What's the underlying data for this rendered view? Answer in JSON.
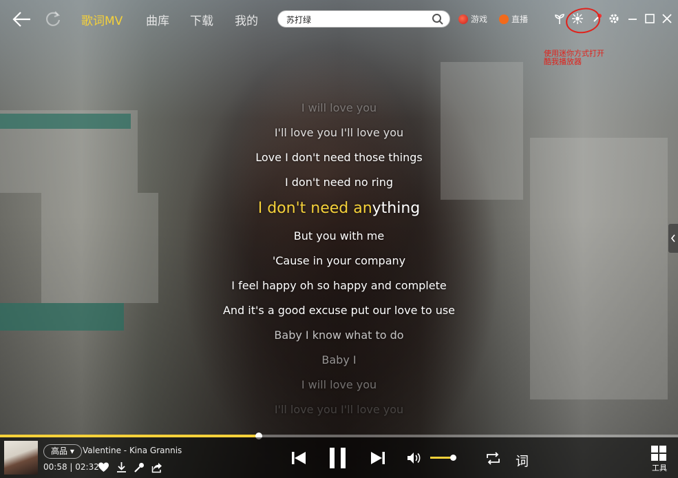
{
  "nav": {
    "tabs": [
      {
        "label": "歌词MV",
        "active": true
      },
      {
        "label": "曲库",
        "active": false
      },
      {
        "label": "下载",
        "active": false
      },
      {
        "label": "我的",
        "active": false
      }
    ]
  },
  "search": {
    "value": "苏打绿"
  },
  "topLinks": {
    "game": "游戏",
    "live": "直播"
  },
  "annotation": "使用迷你方式打开酷我播放器",
  "lyrics": {
    "lines": [
      "I will love you",
      "I'll love you I'll love you",
      "Love I don't need those things",
      "I don't need no ring",
      "But you with me",
      "'Cause in your company",
      "I feel happy oh so happy and complete",
      "And it's a good excuse put our love to use",
      "Baby I know what to do",
      "Baby I",
      "I will love you",
      "I'll love you I'll love you"
    ],
    "current_sung": "I don't need an",
    "current_rest": "ything"
  },
  "player": {
    "quality": "高品",
    "song": "Valentine - Kina Grannis",
    "elapsed": "00:58",
    "duration": "02:32",
    "progress": 0.382,
    "volume": 0.95,
    "lyricsToggle": "词",
    "toolsLabel": "工具"
  },
  "colors": {
    "accent": "#f5d13a",
    "annotation": "#e0221b"
  }
}
